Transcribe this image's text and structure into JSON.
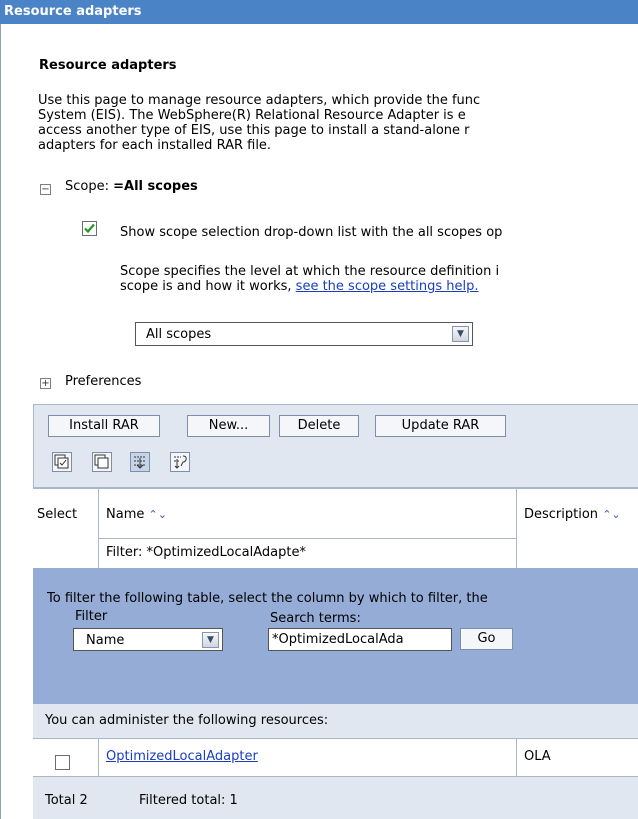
{
  "window": {
    "title": "Resource adapters"
  },
  "page": {
    "heading": "Resource adapters",
    "description_lines": [
      "Use this page to manage resource adapters, which provide the func",
      "System (EIS). The WebSphere(R) Relational Resource Adapter is e",
      "access another type of EIS, use this page to install a stand-alone r",
      "adapters for each installed RAR file."
    ]
  },
  "scope": {
    "label": "Scope:",
    "value": "=All scopes",
    "checkbox_label": "Show scope selection drop-down list with the all scopes op",
    "checked": true,
    "help_line1": "Scope specifies the level at which the resource definition i",
    "help_line2": "scope is and how it works,",
    "help_link": "see the scope settings help.",
    "select_value": "All scopes"
  },
  "preferences": {
    "label": "Preferences"
  },
  "toolbar": {
    "install_rar": "Install RAR",
    "new": "New...",
    "delete": "Delete",
    "update_rar": "Update RAR"
  },
  "table": {
    "columns": {
      "select": "Select",
      "name": "Name",
      "description": "Description"
    },
    "sort_glyph": "⌃⌄",
    "filter_summary": "Filter: *OptimizedLocalAdapte*",
    "administer_text": "You can administer the following resources:",
    "rows": [
      {
        "name": "OptimizedLocalAdapter",
        "description": "OLA",
        "selected": false
      }
    ],
    "footer": {
      "total": "Total 2",
      "filtered_total": "Filtered total: 1"
    }
  },
  "filter": {
    "instruction": "To filter the following table, select the column by which to filter, the",
    "filter_label": "Filter",
    "filter_value": "Name",
    "search_label": "Search terms:",
    "search_value": "*OptimizedLocalAda",
    "go_label": "Go"
  },
  "colors": {
    "titlebar": "#4a83c6",
    "filter_panel": "#95acd6",
    "toolbar": "#e0e7f0",
    "link": "#1a3dbd"
  }
}
